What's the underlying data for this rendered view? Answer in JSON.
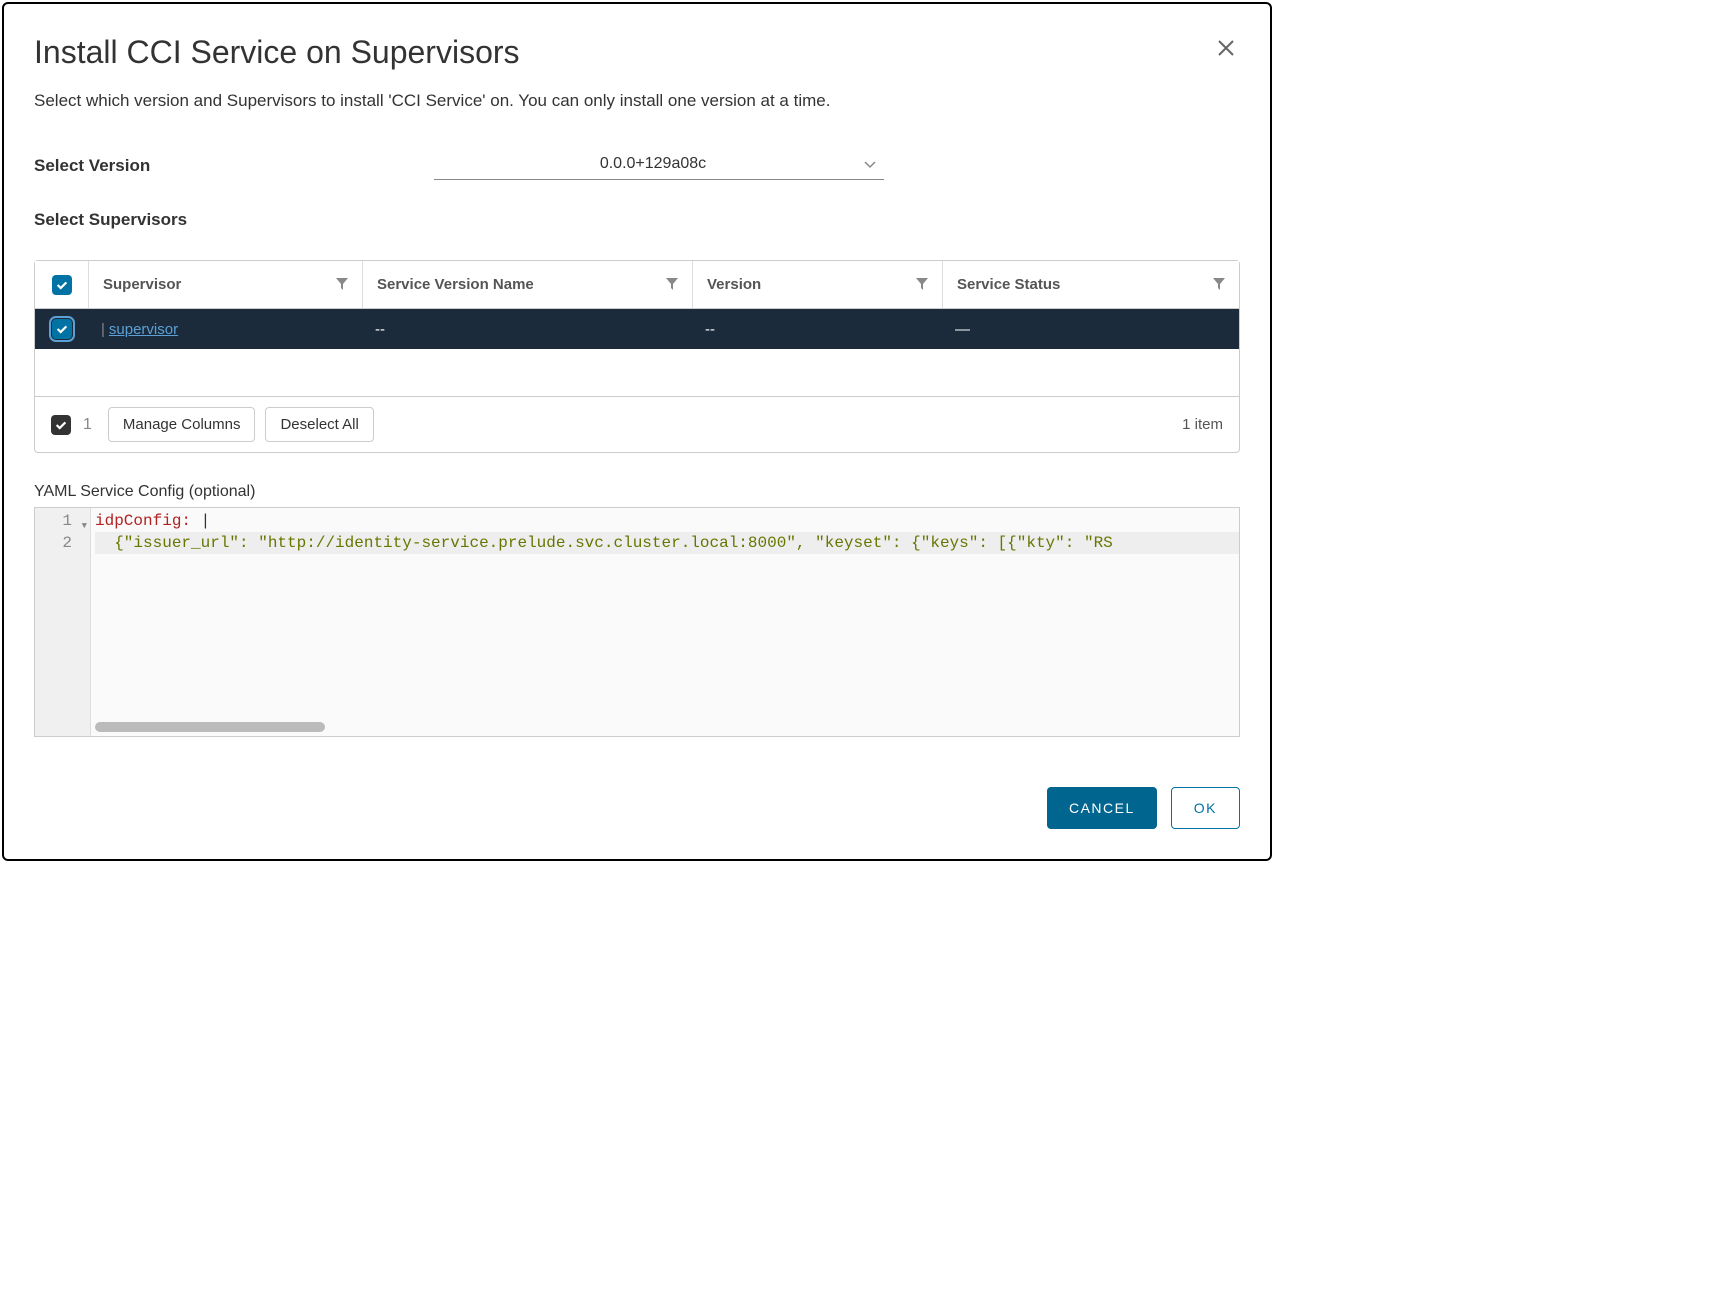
{
  "dialog": {
    "title": "Install CCI Service on Supervisors",
    "description": "Select which version and Supervisors to install 'CCI Service' on. You can only install one version at a time."
  },
  "version": {
    "label": "Select Version",
    "selected": "0.0.0+129a08c"
  },
  "supervisors": {
    "label": "Select Supervisors",
    "columns": {
      "supervisor": "Supervisor",
      "service_version_name": "Service Version Name",
      "version": "Version",
      "service_status": "Service Status"
    },
    "rows": [
      {
        "name": "supervisor",
        "service_version_name": "--",
        "version": "--",
        "service_status": "—"
      }
    ],
    "selected_count": "1",
    "footer": {
      "manage_columns": "Manage Columns",
      "deselect_all": "Deselect All",
      "item_count": "1 item"
    }
  },
  "yaml": {
    "label": "YAML Service Config (optional)",
    "lines": {
      "l1_key": "idpConfig:",
      "l1_pipe": " |",
      "l2": "{\"issuer_url\": \"http://identity-service.prelude.svc.cluster.local:8000\", \"keyset\": {\"keys\": [{\"kty\": \"RS"
    }
  },
  "actions": {
    "cancel": "CANCEL",
    "ok": "OK"
  }
}
